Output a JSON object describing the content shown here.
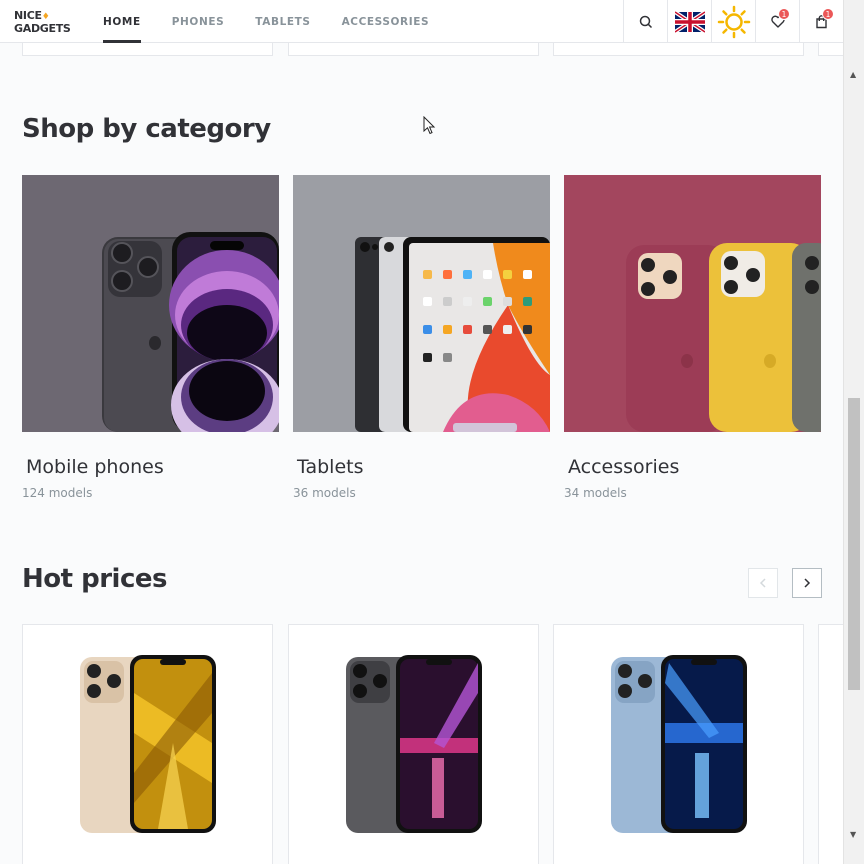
{
  "header": {
    "logo_line1": "NICE",
    "logo_line2": "GADGETS",
    "nav": [
      {
        "label": "HOME",
        "active": true
      },
      {
        "label": "PHONES",
        "active": false
      },
      {
        "label": "TABLETS",
        "active": false
      },
      {
        "label": "ACCESSORIES",
        "active": false
      }
    ],
    "favourites_count": "1",
    "cart_count": "1",
    "icons": [
      "search-icon",
      "uk-flag-icon",
      "sun-theme-icon",
      "heart-icon",
      "shopping-bag-icon"
    ]
  },
  "categories_section": {
    "title": "Shop by category",
    "items": [
      {
        "name": "Mobile phones",
        "count": "124 models",
        "bg": "#6d6872"
      },
      {
        "name": "Tablets",
        "count": "36 models",
        "bg": "#9c9ea4"
      },
      {
        "name": "Accessories",
        "count": "34 models",
        "bg": "#a3465e"
      }
    ]
  },
  "hot_prices_section": {
    "title": "Hot prices",
    "products": [
      {
        "image": "iphone-gold",
        "color": "#e8d6c0"
      },
      {
        "image": "iphone-graphite",
        "color": "#5a5a5e"
      },
      {
        "image": "iphone-sierra-blue",
        "color": "#9cb8d6"
      }
    ]
  },
  "colors": {
    "primary": "#313237",
    "secondary": "#89939a",
    "badge": "#eb5757"
  }
}
